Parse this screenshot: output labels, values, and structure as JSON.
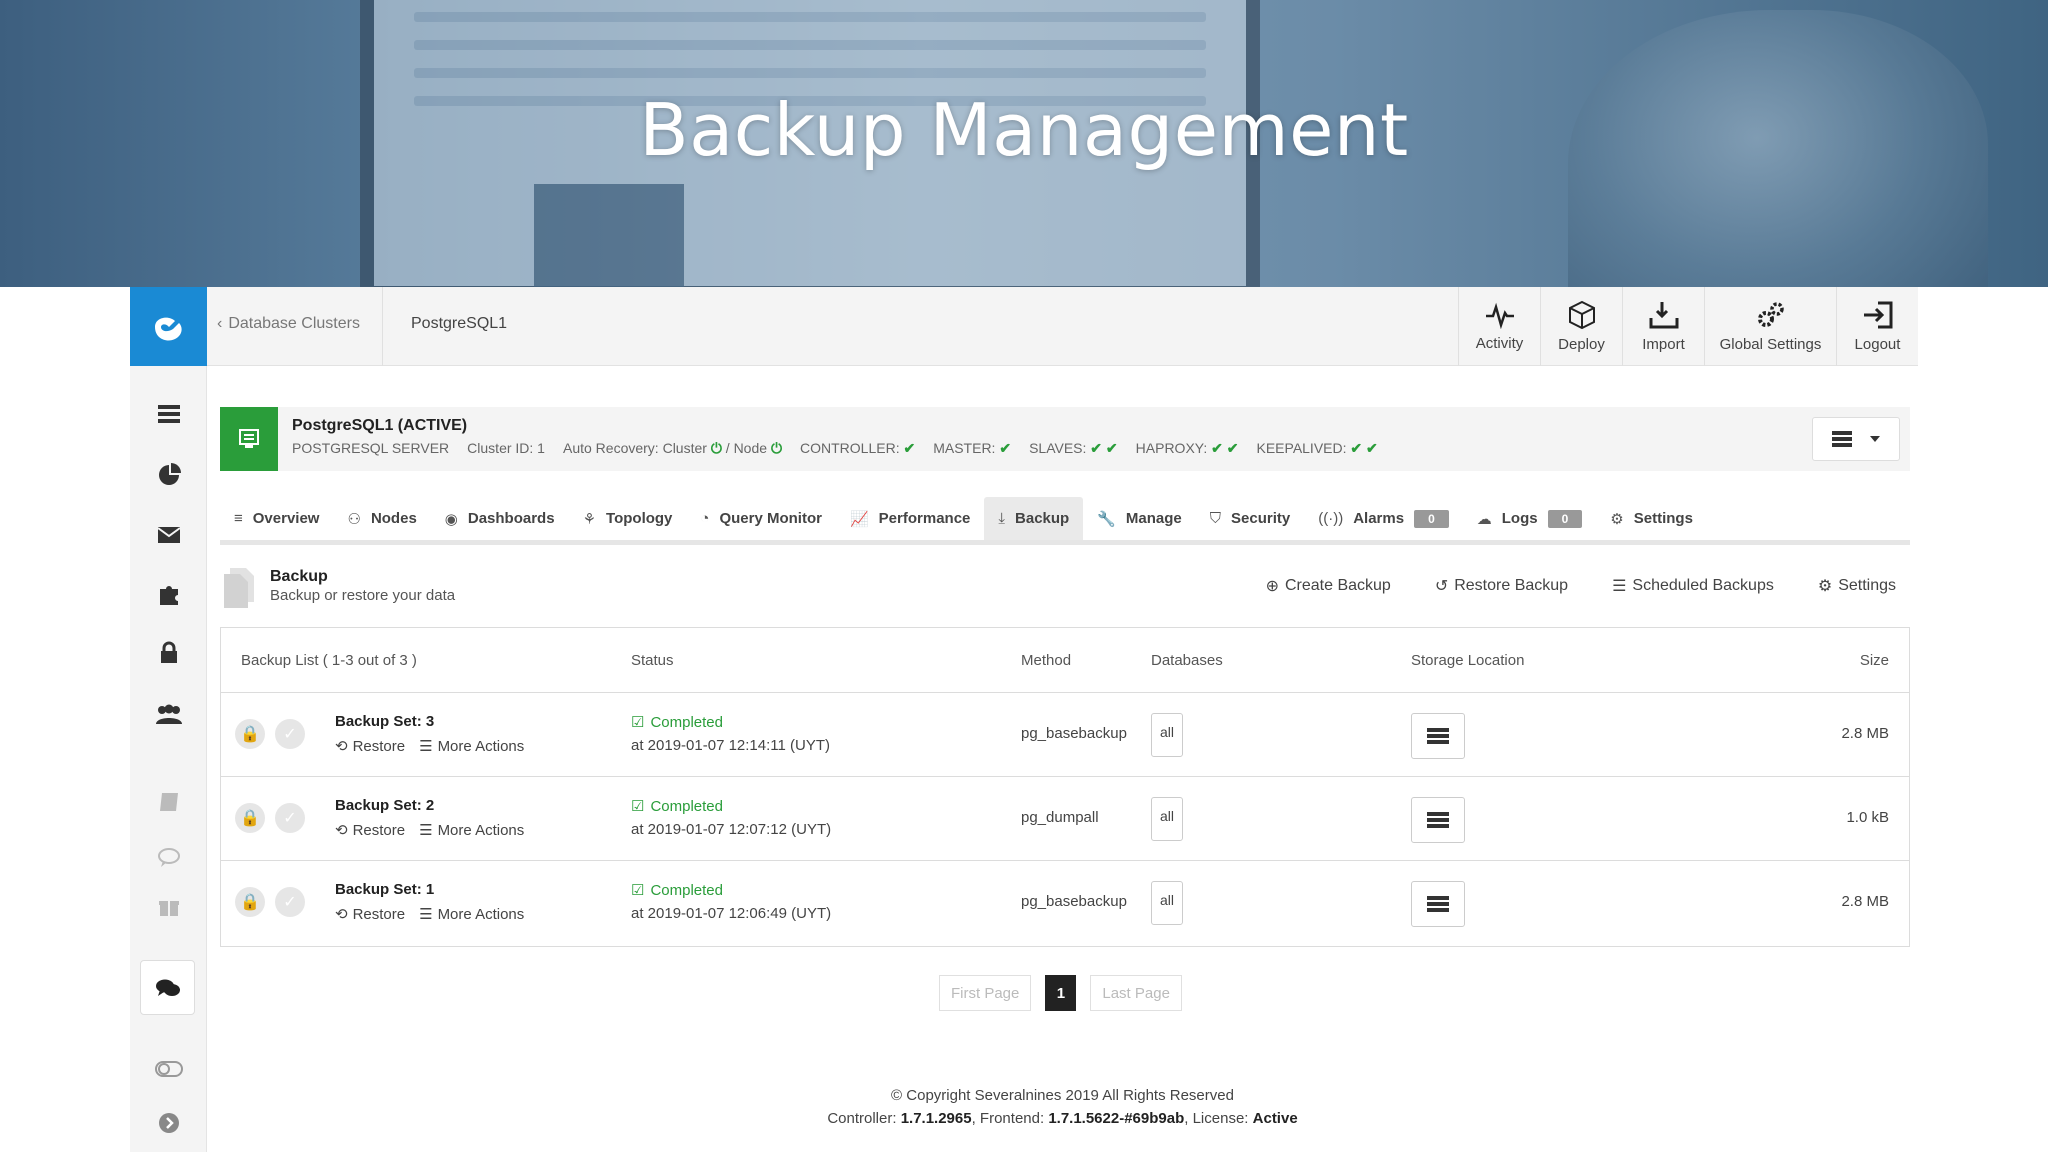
{
  "banner": {
    "title": "Backup Management"
  },
  "breadcrumb": {
    "back_label": "Database Clusters",
    "current": "PostgreSQL1"
  },
  "topnav": [
    {
      "label": "Activity",
      "icon": "activity-icon"
    },
    {
      "label": "Deploy",
      "icon": "deploy-icon"
    },
    {
      "label": "Import",
      "icon": "import-icon"
    },
    {
      "label": "Global Settings",
      "icon": "global-settings-icon"
    },
    {
      "label": "Logout",
      "icon": "logout-icon"
    }
  ],
  "cluster": {
    "name": "PostgreSQL1 (ACTIVE)",
    "type": "POSTGRESQL SERVER",
    "cluster_id": "Cluster ID: 1",
    "auto_recovery_label": "Auto Recovery: Cluster",
    "auto_recovery_node": "/ Node",
    "controller": "CONTROLLER:",
    "master": "MASTER:",
    "slaves": "SLAVES:",
    "haproxy": "HAPROXY:",
    "keepalived": "KEEPALIVED:"
  },
  "tabs": [
    {
      "label": "Overview",
      "icon": "≡"
    },
    {
      "label": "Nodes",
      "icon": "⚇"
    },
    {
      "label": "Dashboards",
      "icon": "◉"
    },
    {
      "label": "Topology",
      "icon": "⚘"
    },
    {
      "label": "Query Monitor",
      "icon": "◔"
    },
    {
      "label": "Performance",
      "icon": "📈"
    },
    {
      "label": "Backup",
      "icon": "⤓",
      "active": true
    },
    {
      "label": "Manage",
      "icon": "🔧"
    },
    {
      "label": "Security",
      "icon": "⛉"
    },
    {
      "label": "Alarms",
      "icon": "((·))",
      "badge": "0"
    },
    {
      "label": "Logs",
      "icon": "☁",
      "badge": "0"
    },
    {
      "label": "Settings",
      "icon": "⚙"
    }
  ],
  "section": {
    "title": "Backup",
    "subtitle": "Backup or restore your data",
    "actions": {
      "create": "Create Backup",
      "restore": "Restore Backup",
      "scheduled": "Scheduled Backups",
      "settings": "Settings"
    }
  },
  "table": {
    "headers": {
      "list": "Backup List ( 1-3 out of 3 )",
      "status": "Status",
      "method": "Method",
      "databases": "Databases",
      "storage": "Storage Location",
      "size": "Size"
    },
    "row_actions": {
      "restore": "Restore",
      "more": "More Actions"
    },
    "rows": [
      {
        "name": "Backup Set: 3",
        "status": "Completed",
        "date": "at 2019-01-07 12:14:11 (UYT)",
        "method": "pg_basebackup",
        "databases": "all",
        "size": "2.8 MB"
      },
      {
        "name": "Backup Set: 2",
        "status": "Completed",
        "date": "at 2019-01-07 12:07:12 (UYT)",
        "method": "pg_dumpall",
        "databases": "all",
        "size": "1.0 kB"
      },
      {
        "name": "Backup Set: 1",
        "status": "Completed",
        "date": "at 2019-01-07 12:06:49 (UYT)",
        "method": "pg_basebackup",
        "databases": "all",
        "size": "2.8 MB"
      }
    ]
  },
  "pagination": {
    "first": "First Page",
    "current": "1",
    "last": "Last Page"
  },
  "footer": {
    "copyright": "© Copyright Severalnines 2019 All Rights Reserved",
    "controller_label": "Controller:",
    "controller_version": "1.7.1.2965",
    "frontend_label": ", Frontend:",
    "frontend_version": "1.7.1.5622-#69b9ab",
    "license_label": ", License:",
    "license_value": "Active"
  },
  "colors": {
    "brand_blue": "#1a8ad4",
    "success_green": "#2a9d3a"
  }
}
